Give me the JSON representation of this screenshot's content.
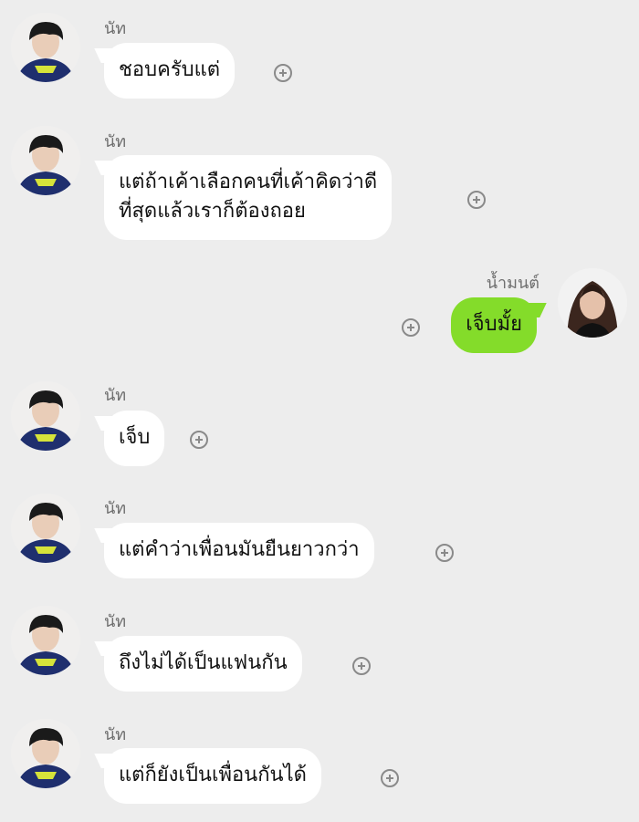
{
  "colors": {
    "background": "#ededed",
    "incoming_bubble": "#ffffff",
    "outgoing_bubble": "#84dc2a",
    "name_text": "#6f6f6f",
    "hoodie": "#1f2f6e",
    "hoodie_print": "#d6e33a"
  },
  "messages": [
    {
      "sender": "นัท",
      "text": "ชอบครับแต่",
      "direction": "incoming"
    },
    {
      "sender": "นัท",
      "text": "แต่ถ้าเค้าเลือกคนที่เค้าคิดว่าดี\nที่สุดแล้วเราก็ต้องถอย",
      "direction": "incoming"
    },
    {
      "sender": "น้ำมนต์",
      "text": "เจ็บมั้ย",
      "direction": "outgoing"
    },
    {
      "sender": "นัท",
      "text": "เจ็บ",
      "direction": "incoming"
    },
    {
      "sender": "นัท",
      "text": "แต่คำว่าเพื่อนมันยืนยาวกว่า",
      "direction": "incoming"
    },
    {
      "sender": "นัท",
      "text": "ถึงไม่ได้เป็นแฟนกัน",
      "direction": "incoming"
    },
    {
      "sender": "นัท",
      "text": "แต่ก็ยังเป็นเพื่อนกันได้",
      "direction": "incoming"
    }
  ],
  "icons": {
    "reaction": "plus-circle-icon",
    "incoming_avatar": "boy-avatar",
    "outgoing_avatar": "girl-avatar"
  }
}
